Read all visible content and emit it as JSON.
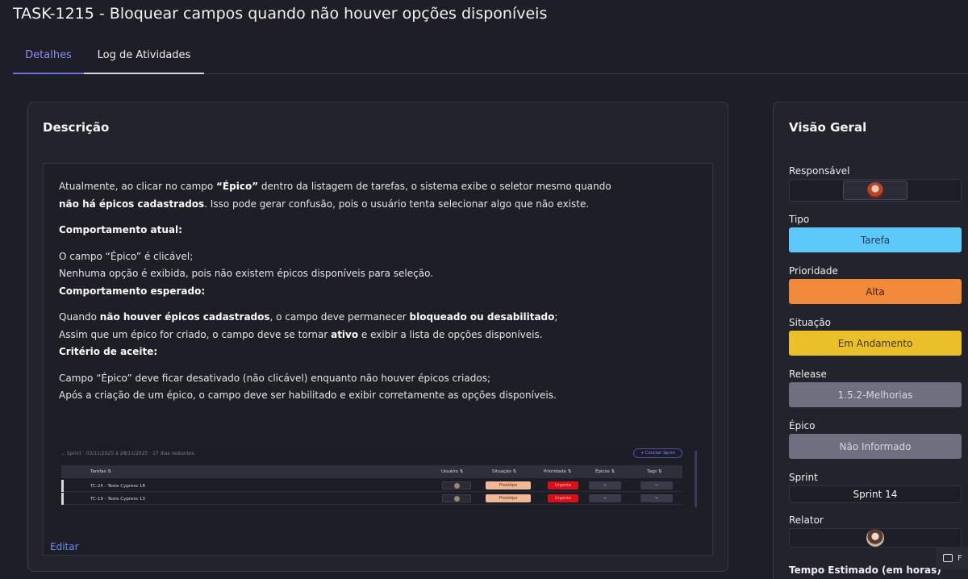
{
  "header": {
    "title": "TASK-1215 - Bloquear campos quando não houver opções disponíveis"
  },
  "tabs": [
    {
      "label": "Detalhes",
      "active": true
    },
    {
      "label": "Log de Atividades",
      "active": false
    }
  ],
  "description": {
    "title": "Descrição",
    "p1a": "Atualmente, ao clicar no campo ",
    "p1b": "“Épico”",
    "p1c": " dentro da listagem de tarefas, o sistema exibe o seletor mesmo quando ",
    "p1d": "não há épicos cadastrados",
    "p1e": ". Isso pode gerar confusão, pois o usuário tenta selecionar algo que não existe.",
    "h1": "Comportamento atual:",
    "a1": "O campo “Épico” é clicável;",
    "a2": "Nenhuma opção é exibida, pois não existem épicos disponíveis para seleção.",
    "h2": "Comportamento esperado:",
    "e1a": "Quando ",
    "e1b": "não houver épicos cadastrados",
    "e1c": ", o campo deve permanecer ",
    "e1d": "bloqueado ou desabilitado",
    "e1e": ";",
    "e2a": "Assim que um épico for criado, o campo deve se tornar ",
    "e2b": "ativo",
    "e2c": " e exibir a lista de opções disponíveis.",
    "h3": "Critério de aceite:",
    "c1": "Campo “Épico” deve ficar desativado (não clicável) enquanto não houver épicos criados;",
    "c2": "Após a criação de um épico, o campo deve ser habilitado e exibir corretamente as opções disponíveis.",
    "screenshot": {
      "sprint_line": "⌄ Sprint ·  03/11/2025 à 28/11/2025 · 17 dias restantes",
      "new_sprint": "+ Concluir Sprint",
      "columns": [
        "Tarefas ⇅",
        "Usuário ⇅",
        "Situação ⇅",
        "Prioridade ⇅",
        "Épicos ⇅",
        "Tags ⇅"
      ],
      "rows": [
        {
          "task": "TC-24 - Teste Cypress 18",
          "status": "Protótipo",
          "priority": "Urgente",
          "epic": "+",
          "tags": "+"
        },
        {
          "task": "TC-19 - Teste Cypress 13",
          "status": "Protótipo",
          "priority": "Urgente",
          "epic": "+",
          "tags": "+"
        }
      ]
    },
    "edit_label": "Editar"
  },
  "overview": {
    "title": "Visão Geral",
    "responsavel_label": "Responsável",
    "tipo_label": "Tipo",
    "tipo_value": "Tarefa",
    "prioridade_label": "Prioridade",
    "prioridade_value": "Alta",
    "situacao_label": "Situação",
    "situacao_value": "Em Andamento",
    "release_label": "Release",
    "release_value": "1.5.2-Melhorias",
    "epico_label": "Épico",
    "epico_value": "Não Informado",
    "sprint_label": "Sprint",
    "sprint_value": "Sprint 14",
    "relator_label": "Relator",
    "tempo_label": "Tempo Estimado (em horas)"
  },
  "corner": {
    "label": "F"
  },
  "colors": {
    "accent": "#6b6fe0",
    "tipo": "#5dc8fa",
    "prioridade": "#f0893a",
    "situacao": "#e9c02a",
    "muted": "#6e7080"
  }
}
